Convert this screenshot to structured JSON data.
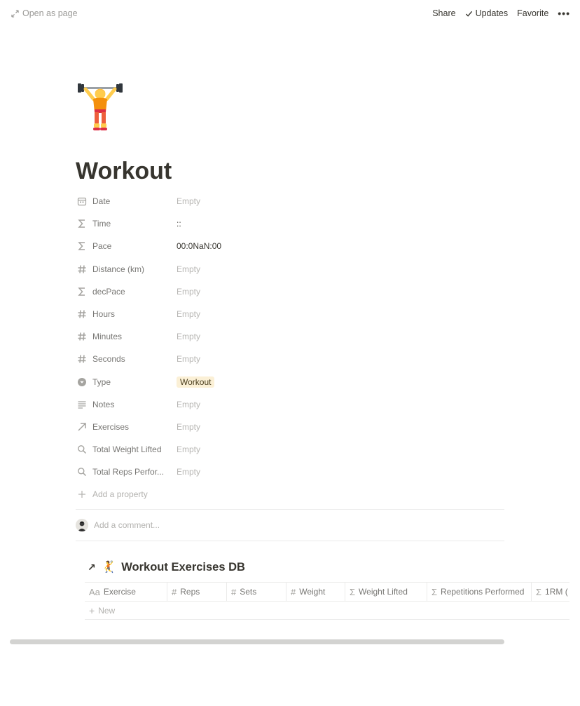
{
  "topbar": {
    "open_as_page": "Open as page",
    "share": "Share",
    "updates": "Updates",
    "favorite": "Favorite",
    "more": "•••"
  },
  "page": {
    "icon": "person-lifting-weights-emoji",
    "title": "Workout"
  },
  "properties": [
    {
      "icon": "calendar-icon",
      "name": "Date",
      "value": "Empty",
      "filled": false
    },
    {
      "icon": "sigma-icon",
      "name": "Time",
      "value": "::",
      "filled": true
    },
    {
      "icon": "sigma-icon",
      "name": "Pace",
      "value": "00:0NaN:00",
      "filled": true
    },
    {
      "icon": "hash-icon",
      "name": "Distance (km)",
      "value": "Empty",
      "filled": false
    },
    {
      "icon": "sigma-icon",
      "name": "decPace",
      "value": "Empty",
      "filled": false
    },
    {
      "icon": "hash-icon",
      "name": "Hours",
      "value": "Empty",
      "filled": false
    },
    {
      "icon": "hash-icon",
      "name": "Minutes",
      "value": "Empty",
      "filled": false
    },
    {
      "icon": "hash-icon",
      "name": "Seconds",
      "value": "Empty",
      "filled": false
    },
    {
      "icon": "select-icon",
      "name": "Type",
      "value": "Workout",
      "filled": true,
      "tag": true
    },
    {
      "icon": "text-lines-icon",
      "name": "Notes",
      "value": "Empty",
      "filled": false
    },
    {
      "icon": "relation-arrow-icon",
      "name": "Exercises",
      "value": "Empty",
      "filled": false
    },
    {
      "icon": "search-icon",
      "name": "Total Weight Lifted",
      "value": "Empty",
      "filled": false
    },
    {
      "icon": "search-icon",
      "name": "Total Reps Perfor...",
      "value": "Empty",
      "filled": false
    }
  ],
  "add_property": "Add a property",
  "comment": {
    "placeholder": "Add a comment..."
  },
  "database": {
    "arrow": "↗",
    "emoji": "🤾",
    "title": "Workout Exercises DB",
    "columns": [
      {
        "icon": "Aa",
        "name": "Exercise",
        "width": 118
      },
      {
        "icon": "#",
        "name": "Reps",
        "width": 85
      },
      {
        "icon": "#",
        "name": "Sets",
        "width": 85
      },
      {
        "icon": "#",
        "name": "Weight",
        "width": 84
      },
      {
        "icon": "Σ",
        "name": "Weight Lifted",
        "width": 117
      },
      {
        "icon": "Σ",
        "name": "Repetitions Performed",
        "width": 149
      },
      {
        "icon": "Σ",
        "name": "1RM (",
        "width": 80
      }
    ],
    "new_label": "New"
  },
  "colors": {
    "text": "#37352f",
    "muted": "#787774",
    "empty": "#b7b6b3",
    "tag_bg": "#fbf0d6",
    "divider": "#ebebea"
  }
}
